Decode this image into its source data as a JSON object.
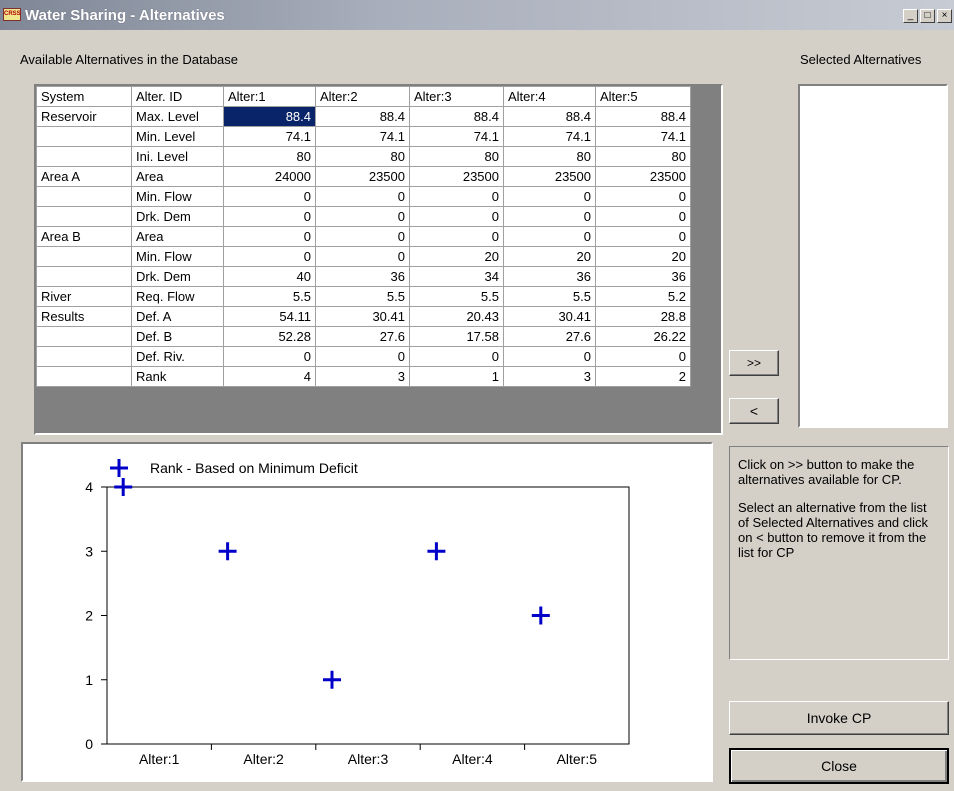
{
  "window": {
    "icon_text": "CRSS",
    "title": "Water Sharing - Alternatives",
    "min_label": "_",
    "max_label": "□",
    "close_label": "×"
  },
  "labels": {
    "available": "Available Alternatives in the Database",
    "selected": "Selected Alternatives"
  },
  "grid": {
    "headers": [
      "System",
      "Alter. ID",
      "Alter:1",
      "Alter:2",
      "Alter:3",
      "Alter:4",
      "Alter:5"
    ],
    "rows": [
      {
        "system": "Reservoir",
        "id": "Max. Level",
        "values": [
          "88.4",
          "88.4",
          "88.4",
          "88.4",
          "88.4"
        ]
      },
      {
        "system": "",
        "id": "Min. Level",
        "values": [
          "74.1",
          "74.1",
          "74.1",
          "74.1",
          "74.1"
        ]
      },
      {
        "system": "",
        "id": "Ini. Level",
        "values": [
          "80",
          "80",
          "80",
          "80",
          "80"
        ]
      },
      {
        "system": "Area A",
        "id": "Area",
        "values": [
          "24000",
          "23500",
          "23500",
          "23500",
          "23500"
        ]
      },
      {
        "system": "",
        "id": "Min. Flow",
        "values": [
          "0",
          "0",
          "0",
          "0",
          "0"
        ]
      },
      {
        "system": "",
        "id": "Drk. Dem",
        "values": [
          "0",
          "0",
          "0",
          "0",
          "0"
        ]
      },
      {
        "system": "Area B",
        "id": "Area",
        "values": [
          "0",
          "0",
          "0",
          "0",
          "0"
        ]
      },
      {
        "system": "",
        "id": "Min. Flow",
        "values": [
          "0",
          "0",
          "20",
          "20",
          "20"
        ]
      },
      {
        "system": "",
        "id": "Drk. Dem",
        "values": [
          "40",
          "36",
          "34",
          "36",
          "36"
        ]
      },
      {
        "system": "River",
        "id": "Req. Flow",
        "values": [
          "5.5",
          "5.5",
          "5.5",
          "5.5",
          "5.2"
        ]
      },
      {
        "system": "Results",
        "id": "Def. A",
        "values": [
          "54.11",
          "30.41",
          "20.43",
          "30.41",
          "28.8"
        ]
      },
      {
        "system": "",
        "id": "Def. B",
        "values": [
          "52.28",
          "27.6",
          "17.58",
          "27.6",
          "26.22"
        ]
      },
      {
        "system": "",
        "id": "Def. Riv.",
        "values": [
          "0",
          "0",
          "0",
          "0",
          "0"
        ]
      },
      {
        "system": "",
        "id": "Rank",
        "values": [
          "4",
          "3",
          "1",
          "3",
          "2"
        ]
      }
    ]
  },
  "buttons": {
    "add": ">>",
    "remove": "<",
    "invoke": "Invoke CP",
    "close": "Close"
  },
  "info": {
    "para1": "Click on >>  button to make the alternatives available for CP.",
    "para2": "Select an alternative from the list of Selected Alternatives and click on < button to remove it from the list for CP"
  },
  "chart_data": {
    "type": "scatter",
    "title": "",
    "xlabel": "",
    "ylabel": "",
    "categories": [
      "Alter:1",
      "Alter:2",
      "Alter:3",
      "Alter:4",
      "Alter:5"
    ],
    "series": [
      {
        "name": "Rank - Based on Minimum Deficit",
        "values": [
          4,
          3,
          1,
          3,
          2
        ],
        "color": "#0000c8",
        "marker": "cross"
      }
    ],
    "ylim": [
      0,
      4
    ],
    "yticks": [
      0,
      1,
      2,
      3,
      4
    ],
    "grid": false,
    "legend": "top-left"
  }
}
